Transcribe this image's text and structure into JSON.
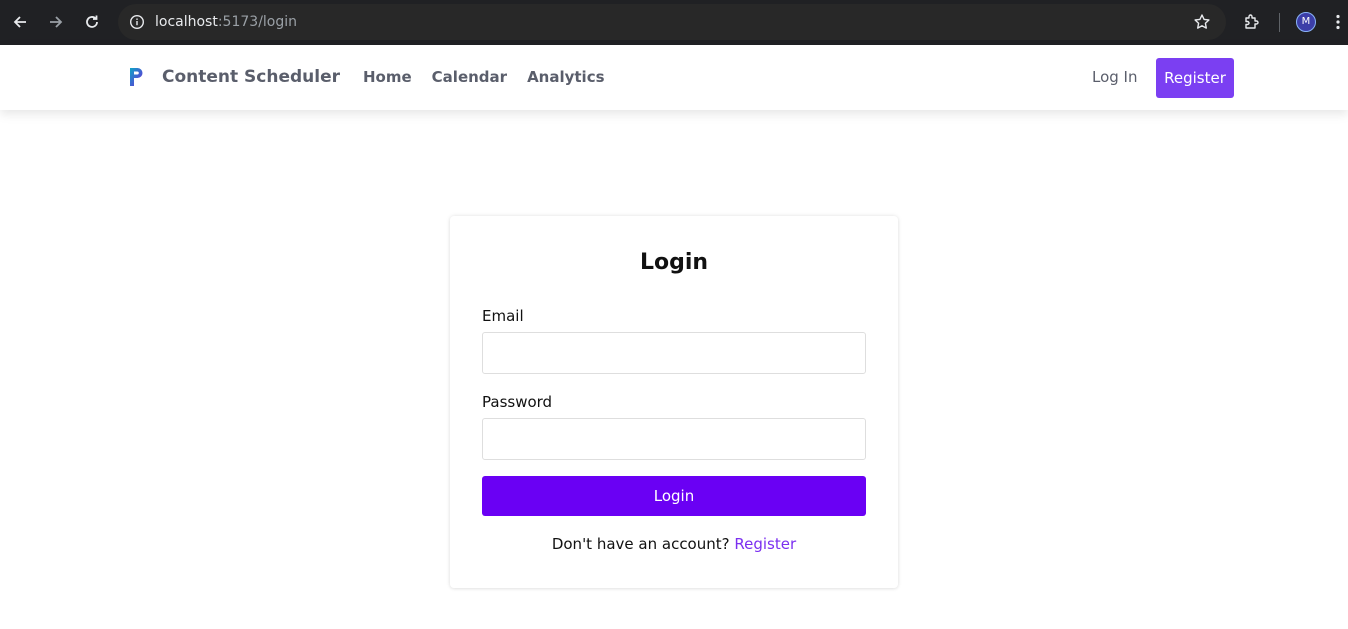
{
  "browser": {
    "url_host": "localhost",
    "url_path": ":5173/login",
    "profile_initial": "M",
    "icons": [
      "back-arrow-icon",
      "forward-arrow-icon",
      "reload-icon",
      "site-info-icon",
      "bookmark-star-icon",
      "extensions-icon",
      "more-menu-icon"
    ]
  },
  "navbar": {
    "brand_name": "Content Scheduler",
    "links": [
      "Home",
      "Calendar",
      "Analytics"
    ],
    "login_label": "Log In",
    "register_label": "Register"
  },
  "login_form": {
    "title": "Login",
    "email_label": "Email",
    "email_value": "",
    "password_label": "Password",
    "password_value": "",
    "submit_label": "Login",
    "footer_prompt": "Don't have an account?",
    "footer_link": "Register"
  },
  "colors": {
    "chrome_bg": "#202124",
    "accent_nav": "#7b3ff2",
    "accent_button": "#6a00f4",
    "link": "#7b2ff0",
    "nav_text": "#5a5e6b"
  }
}
